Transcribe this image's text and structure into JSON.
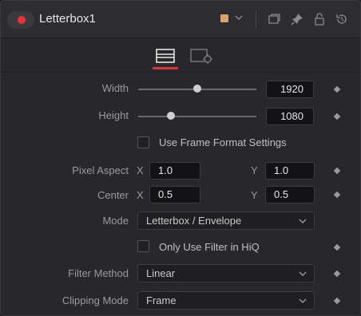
{
  "header": {
    "tool_name": "Letterbox1",
    "swatch_color": "#d9a36a",
    "icons": [
      "enable-toggle",
      "color-swatch",
      "chevron-down-icon",
      "window-icon",
      "pin-icon",
      "lock-icon",
      "reset-icon"
    ]
  },
  "tabs": [
    {
      "name": "controls",
      "icon": "controls-tab-icon",
      "active": true
    },
    {
      "name": "settings",
      "icon": "settings-tab-icon",
      "active": false
    }
  ],
  "controls": {
    "width": {
      "label": "Width",
      "value": "1920",
      "slider_fraction": 0.5
    },
    "height": {
      "label": "Height",
      "value": "1080",
      "slider_fraction": 0.28
    },
    "use_frame_format": {
      "label": "Use Frame Format Settings",
      "checked": false
    },
    "pixel_aspect": {
      "label": "Pixel Aspect",
      "x_label": "X",
      "x": "1.0",
      "y_label": "Y",
      "y": "1.0"
    },
    "center": {
      "label": "Center",
      "x_label": "X",
      "x": "0.5",
      "y_label": "Y",
      "y": "0.5"
    },
    "mode": {
      "label": "Mode",
      "value": "Letterbox / Envelope"
    },
    "hiq": {
      "label": "Only Use Filter in HiQ",
      "checked": false
    },
    "filter_method": {
      "label": "Filter Method",
      "value": "Linear"
    },
    "clipping_mode": {
      "label": "Clipping Mode",
      "value": "Frame"
    }
  },
  "accent_color": "#d9383f"
}
